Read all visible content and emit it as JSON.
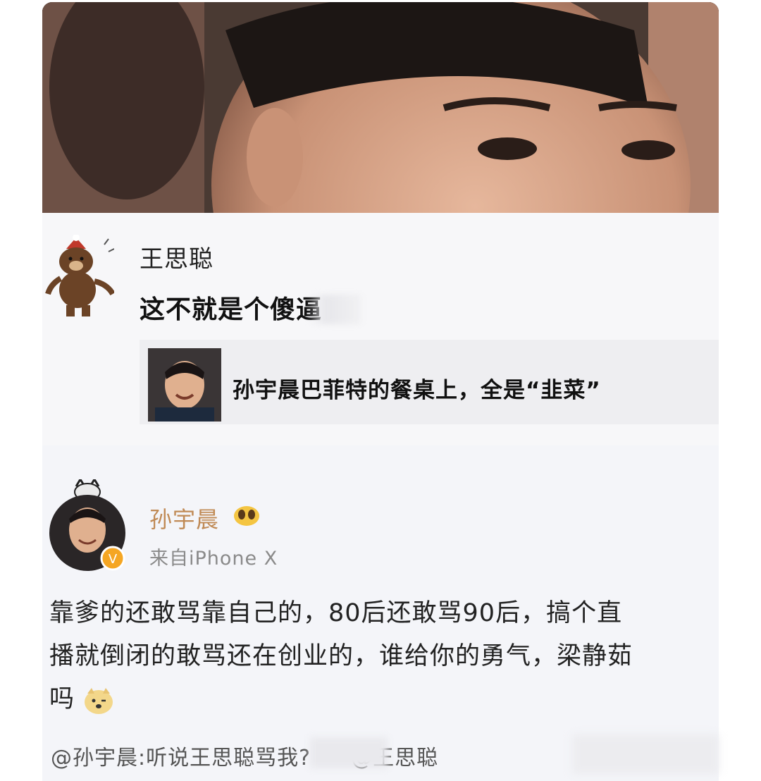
{
  "post1": {
    "author": "王思聪",
    "content": "这不就是个傻逼",
    "repost": {
      "title": "孙宇晨巴菲特的餐桌上，全是“韭菜”"
    }
  },
  "post2": {
    "author": "孙宇晨",
    "source": "来自iPhone X",
    "content_line1": "靠爹的还敢骂靠自己的，80后还敢骂90后，搞个直",
    "content_line2": "播就倒闭的敢骂还在创业的，谁给你的勇气，梁静茹",
    "content_line3": "吗",
    "footer": "@孙宇晨:听说王思聪骂我?",
    "footer_mention": "@王思聪"
  },
  "colors": {
    "author2": "#c08a55",
    "source": "#8a8a8a",
    "card_bg": "#f4f5f9"
  },
  "icons": {
    "sticker": "bear-sticker-icon",
    "avatar2": "user-avatar-icon",
    "vip": "gold-v-badge-icon",
    "emoji": "doge-emoji-icon"
  }
}
